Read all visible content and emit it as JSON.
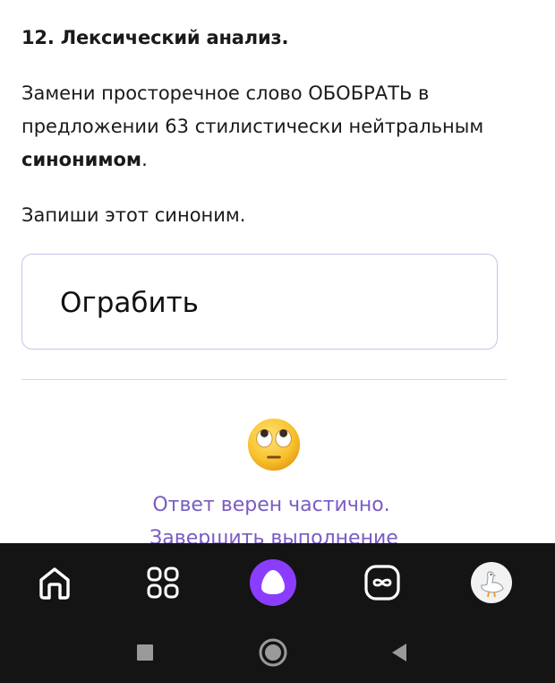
{
  "task": {
    "title": "12. Лексический анализ.",
    "text_part1": "Замени просторечное слово ОБОБРАТЬ в предложении 63 стилистически нейтральным ",
    "text_bold": "синонимом",
    "text_part2": ".",
    "instruction": "Запиши этот синоним."
  },
  "answer": {
    "value": "Ограбить"
  },
  "result": {
    "emoji": "face-with-rolling-eyes",
    "status": "Ответ верен частично.",
    "finish_link": "Завершить выполнение"
  },
  "bottom_nav": {
    "items": [
      {
        "icon": "home-icon"
      },
      {
        "icon": "services-grid-icon"
      },
      {
        "icon": "alice-assistant-icon"
      },
      {
        "icon": "infinity-feed-icon"
      },
      {
        "icon": "profile-avatar-goose"
      }
    ]
  },
  "system_nav": {
    "items": [
      {
        "icon": "recents-square-icon"
      },
      {
        "icon": "home-circle-icon"
      },
      {
        "icon": "back-triangle-icon"
      }
    ]
  },
  "colors": {
    "accent": "#7a5bc4",
    "alice": "#8b3dff",
    "nav_bg": "#141414"
  }
}
